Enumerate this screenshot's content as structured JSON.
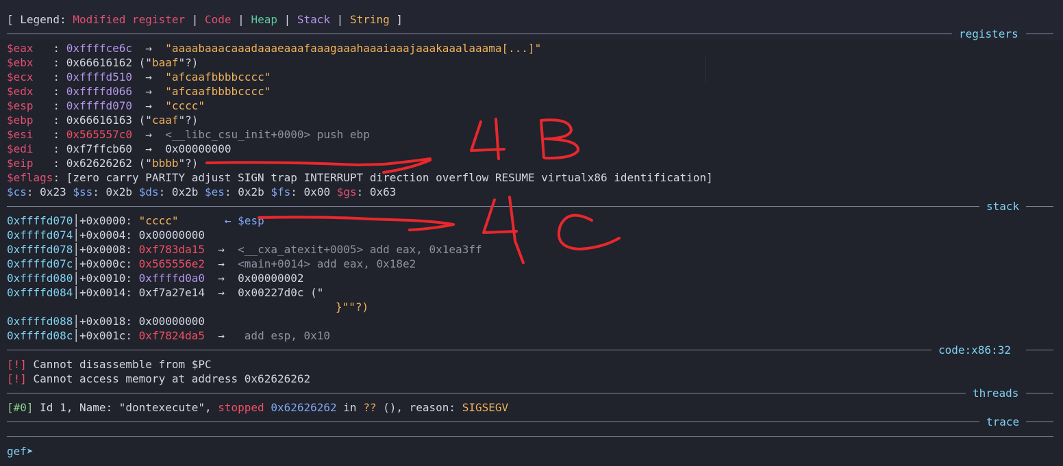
{
  "legend": {
    "open": "[ Legend: ",
    "modified": "Modified register",
    "sep1": " | ",
    "code": "Code",
    "sep2": " | ",
    "heap": "Heap",
    "sep3": " | ",
    "stack": "Stack",
    "sep4": " | ",
    "string": "String",
    "close": " ]"
  },
  "sections": {
    "registers": "registers",
    "stack": "stack",
    "code": "code:x86:32",
    "threads": "threads",
    "trace": "trace"
  },
  "registers": {
    "eax": {
      "name": "$eax",
      "colon": "   : ",
      "value": "0xffffce6c",
      "arrow": "  →  ",
      "deref": "\"aaaabaaacaaadaaaeaaafaaagaaahaaaiaaajaaakaaalaaama[...]\""
    },
    "ebx": {
      "name": "$ebx",
      "colon": "   : ",
      "value": "0x66616162",
      "open": " (\"",
      "str": "baaf",
      "close": "\"?)"
    },
    "ecx": {
      "name": "$ecx",
      "colon": "   : ",
      "value": "0xffffd510",
      "arrow": "  →  ",
      "deref": "\"afcaafbbbbcccc\""
    },
    "edx": {
      "name": "$edx",
      "colon": "   : ",
      "value": "0xffffd066",
      "arrow": "  →  ",
      "deref": "\"afcaafbbbbcccc\""
    },
    "esp": {
      "name": "$esp",
      "colon": "   : ",
      "value": "0xffffd070",
      "arrow": "  →  ",
      "deref": "\"cccc\""
    },
    "ebp": {
      "name": "$ebp",
      "colon": "   : ",
      "value": "0x66616163",
      "open": " (\"",
      "str": "caaf",
      "close": "\"?)"
    },
    "esi": {
      "name": "$esi",
      "colon": "   : ",
      "value": "0x565557c0",
      "arrow": "  →  ",
      "deref": "<__libc_csu_init+0000> push ebp"
    },
    "edi": {
      "name": "$edi",
      "colon": "   : ",
      "value": "0xf7ffcb60",
      "arrow": "  →  ",
      "deref": "0x00000000"
    },
    "eip": {
      "name": "$eip",
      "colon": "   : ",
      "value": "0x62626262",
      "open": " (\"",
      "str": "bbbb",
      "close": "\"?)"
    },
    "eflags": {
      "name": "$eflags",
      "rest": ": [zero carry PARITY adjust SIGN trap INTERRUPT direction overflow RESUME virtualx86 identification]"
    },
    "segments": {
      "cs": "$cs",
      "cs_val": ": 0x23 ",
      "ss": "$ss",
      "ss_val": ": 0x2b ",
      "ds": "$ds",
      "ds_val": ": 0x2b ",
      "es": "$es",
      "es_val": ": 0x2b ",
      "fs": "$fs",
      "fs_val": ": 0x00 ",
      "gs": "$gs",
      "gs_val": ": 0x63"
    }
  },
  "stack": [
    {
      "addr": "0xffffd070",
      "bar": "│",
      "off": "+0x0000: ",
      "val": "\"cccc\"",
      "tail": "       ",
      "ptr": "← $esp"
    },
    {
      "addr": "0xffffd074",
      "bar": "│",
      "off": "+0x0004: ",
      "val": "0x00000000"
    },
    {
      "addr": "0xffffd078",
      "bar": "│",
      "off": "+0x0008: ",
      "val": "0xf783da15",
      "arrow": "  →  ",
      "deref": "<__cxa_atexit+0005> add eax, 0x1ea3ff"
    },
    {
      "addr": "0xffffd07c",
      "bar": "│",
      "off": "+0x000c: ",
      "val": "0x565556e2",
      "arrow": "  →  ",
      "deref": "<main+0014> add eax, 0x18e2"
    },
    {
      "addr": "0xffffd080",
      "bar": "│",
      "off": "+0x0010: ",
      "val": "0xffffd0a0",
      "arrow": "  →  ",
      "deref": "0x00000002"
    },
    {
      "addr": "0xffffd084",
      "bar": "│",
      "off": "+0x0014: ",
      "val": "0xf7a27e14",
      "arrow": "  →  ",
      "deref": "0x00227d0c (\""
    },
    {
      "cont": "}\"\"?)"
    },
    {
      "addr": "0xffffd088",
      "bar": "│",
      "off": "+0x0018: ",
      "val": "0x00000000"
    },
    {
      "addr": "0xffffd08c",
      "bar": "│",
      "off": "+0x001c: ",
      "val": "0xf7824da5",
      "arrow": "  →   ",
      "deref": "add esp, 0x10"
    }
  ],
  "code": {
    "line1_tag": "[!]",
    "line1": " Cannot disassemble from $PC",
    "line2_tag": "[!]",
    "line2": " Cannot access memory at address 0x62626262"
  },
  "threads": {
    "tag": "[#0]",
    "t1": " Id 1, Name: \"dontexecute\", ",
    "stopped": "stopped",
    "t2": " ",
    "addr": "0x62626262",
    "t3": " in ",
    "q": "??",
    "t4": " (), reason: ",
    "reason": "SIGSEGV"
  },
  "prompt": "gef➤",
  "colors": {
    "annotation": "#e8282c"
  }
}
